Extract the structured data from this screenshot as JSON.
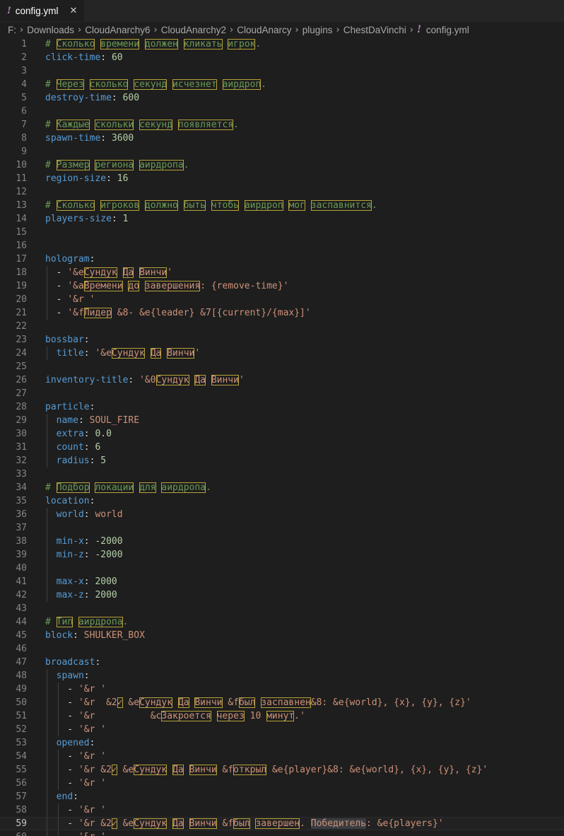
{
  "tab": {
    "label": "config.yml",
    "icon": "yaml-file-icon",
    "close": "✕"
  },
  "breadcrumb": [
    "F:",
    "Downloads",
    "CloudAnarchy6",
    "CloudAnarchy2",
    "CloudAnarcy",
    "plugins",
    "ChestDaVinchi",
    "config.yml"
  ],
  "colors": {
    "key": "#569cd6",
    "string": "#ce9178",
    "number": "#b5cea8",
    "comment": "#6a9955",
    "background": "#1e1e1e"
  },
  "current_line": 59,
  "lines": [
    {
      "n": "1",
      "t": [
        [
          "c",
          "# "
        ],
        [
          "cu",
          "Сколько"
        ],
        [
          "c",
          " "
        ],
        [
          "cu",
          "времени"
        ],
        [
          "c",
          " "
        ],
        [
          "cu",
          "должен"
        ],
        [
          "c",
          " "
        ],
        [
          "cu",
          "кликать"
        ],
        [
          "c",
          " "
        ],
        [
          "cu",
          "игрок"
        ],
        [
          "c",
          "."
        ]
      ]
    },
    {
      "n": "2",
      "t": [
        [
          "k",
          "click-time"
        ],
        [
          "p",
          ": "
        ],
        [
          "n",
          "60"
        ]
      ]
    },
    {
      "n": "3",
      "t": []
    },
    {
      "n": "4",
      "t": [
        [
          "c",
          "# "
        ],
        [
          "cu",
          "Через"
        ],
        [
          "c",
          " "
        ],
        [
          "cu",
          "сколько"
        ],
        [
          "c",
          " "
        ],
        [
          "cu",
          "секунд"
        ],
        [
          "c",
          " "
        ],
        [
          "cu",
          "исчезнет"
        ],
        [
          "c",
          " "
        ],
        [
          "cu",
          "аирдроп"
        ],
        [
          "c",
          "."
        ]
      ]
    },
    {
      "n": "5",
      "t": [
        [
          "k",
          "destroy-time"
        ],
        [
          "p",
          ": "
        ],
        [
          "n",
          "600"
        ]
      ]
    },
    {
      "n": "6",
      "t": []
    },
    {
      "n": "7",
      "t": [
        [
          "c",
          "# "
        ],
        [
          "cu",
          "Каждые"
        ],
        [
          "c",
          " "
        ],
        [
          "cu",
          "скольки"
        ],
        [
          "c",
          " "
        ],
        [
          "cu",
          "секунд"
        ],
        [
          "c",
          " "
        ],
        [
          "cu",
          "появляется"
        ],
        [
          "c",
          "."
        ]
      ]
    },
    {
      "n": "8",
      "t": [
        [
          "k",
          "spawn-time"
        ],
        [
          "p",
          ": "
        ],
        [
          "n",
          "3600"
        ]
      ]
    },
    {
      "n": "9",
      "t": []
    },
    {
      "n": "10",
      "t": [
        [
          "c",
          "# "
        ],
        [
          "cu",
          "Размер"
        ],
        [
          "c",
          " "
        ],
        [
          "cu",
          "региона"
        ],
        [
          "c",
          " "
        ],
        [
          "cu",
          "аирдропа"
        ],
        [
          "c",
          "."
        ]
      ]
    },
    {
      "n": "11",
      "t": [
        [
          "k",
          "region-size"
        ],
        [
          "p",
          ": "
        ],
        [
          "n",
          "16"
        ]
      ]
    },
    {
      "n": "12",
      "t": []
    },
    {
      "n": "13",
      "t": [
        [
          "c",
          "# "
        ],
        [
          "cu",
          "Сколько"
        ],
        [
          "c",
          " "
        ],
        [
          "cu",
          "игроков"
        ],
        [
          "c",
          " "
        ],
        [
          "cu",
          "должно"
        ],
        [
          "c",
          " "
        ],
        [
          "cu",
          "быть"
        ],
        [
          "c",
          " "
        ],
        [
          "cu",
          "чтобь"
        ],
        [
          "c",
          " "
        ],
        [
          "cu",
          "аирдроп"
        ],
        [
          "c",
          " "
        ],
        [
          "cu",
          "мог"
        ],
        [
          "c",
          " "
        ],
        [
          "cu",
          "заспавнится"
        ],
        [
          "c",
          "."
        ]
      ]
    },
    {
      "n": "14",
      "t": [
        [
          "k",
          "players-size"
        ],
        [
          "p",
          ": "
        ],
        [
          "n",
          "1"
        ]
      ]
    },
    {
      "n": "15",
      "t": []
    },
    {
      "n": "16",
      "t": []
    },
    {
      "n": "17",
      "t": [
        [
          "k",
          "hologram"
        ],
        [
          "p",
          ":"
        ]
      ]
    },
    {
      "n": "18",
      "g": [
        1
      ],
      "t": [
        [
          "p",
          "  - "
        ],
        [
          "s",
          "'&e"
        ],
        [
          "su",
          "Сундук"
        ],
        [
          "s",
          " "
        ],
        [
          "su",
          "Да"
        ],
        [
          "s",
          " "
        ],
        [
          "su",
          "Винчи"
        ],
        [
          "s",
          "'"
        ]
      ]
    },
    {
      "n": "19",
      "g": [
        1
      ],
      "t": [
        [
          "p",
          "  - "
        ],
        [
          "s",
          "'&a"
        ],
        [
          "su",
          "Времени"
        ],
        [
          "s",
          " "
        ],
        [
          "su",
          "до"
        ],
        [
          "s",
          " "
        ],
        [
          "su",
          "завершения"
        ],
        [
          "s",
          ": {remove-time}'"
        ]
      ]
    },
    {
      "n": "20",
      "g": [
        1
      ],
      "t": [
        [
          "p",
          "  - "
        ],
        [
          "s",
          "'&r '"
        ]
      ]
    },
    {
      "n": "21",
      "g": [
        1
      ],
      "t": [
        [
          "p",
          "  - "
        ],
        [
          "s",
          "'&f"
        ],
        [
          "su",
          "Лидер"
        ],
        [
          "s",
          " &8- &e{leader} &7[{current}/{max}]'"
        ]
      ]
    },
    {
      "n": "22",
      "t": []
    },
    {
      "n": "23",
      "t": [
        [
          "k",
          "bossbar"
        ],
        [
          "p",
          ":"
        ]
      ]
    },
    {
      "n": "24",
      "g": [
        1
      ],
      "t": [
        [
          "p",
          "  "
        ],
        [
          "k",
          "title"
        ],
        [
          "p",
          ": "
        ],
        [
          "s",
          "'&e"
        ],
        [
          "su",
          "Сундук"
        ],
        [
          "s",
          " "
        ],
        [
          "su",
          "Да"
        ],
        [
          "s",
          " "
        ],
        [
          "su",
          "Винчи"
        ],
        [
          "s",
          "'"
        ]
      ]
    },
    {
      "n": "25",
      "t": []
    },
    {
      "n": "26",
      "t": [
        [
          "k",
          "inventory-title"
        ],
        [
          "p",
          ": "
        ],
        [
          "s",
          "'&0"
        ],
        [
          "su",
          "Сундук"
        ],
        [
          "s",
          " "
        ],
        [
          "su",
          "Да"
        ],
        [
          "s",
          " "
        ],
        [
          "su",
          "Винчи"
        ],
        [
          "s",
          "'"
        ]
      ]
    },
    {
      "n": "27",
      "t": []
    },
    {
      "n": "28",
      "t": [
        [
          "k",
          "particle"
        ],
        [
          "p",
          ":"
        ]
      ]
    },
    {
      "n": "29",
      "g": [
        1
      ],
      "t": [
        [
          "p",
          "  "
        ],
        [
          "k",
          "name"
        ],
        [
          "p",
          ": "
        ],
        [
          "s",
          "SOUL_FIRE"
        ]
      ]
    },
    {
      "n": "30",
      "g": [
        1
      ],
      "t": [
        [
          "p",
          "  "
        ],
        [
          "k",
          "extra"
        ],
        [
          "p",
          ": "
        ],
        [
          "n",
          "0.0"
        ]
      ]
    },
    {
      "n": "31",
      "g": [
        1
      ],
      "t": [
        [
          "p",
          "  "
        ],
        [
          "k",
          "count"
        ],
        [
          "p",
          ": "
        ],
        [
          "n",
          "6"
        ]
      ]
    },
    {
      "n": "32",
      "g": [
        1
      ],
      "t": [
        [
          "p",
          "  "
        ],
        [
          "k",
          "radius"
        ],
        [
          "p",
          ": "
        ],
        [
          "n",
          "5"
        ]
      ]
    },
    {
      "n": "33",
      "t": []
    },
    {
      "n": "34",
      "t": [
        [
          "c",
          "# "
        ],
        [
          "cu",
          "Подбор"
        ],
        [
          "c",
          " "
        ],
        [
          "cu",
          "локации"
        ],
        [
          "c",
          " "
        ],
        [
          "cu",
          "для"
        ],
        [
          "c",
          " "
        ],
        [
          "cu",
          "аирдропа"
        ],
        [
          "c",
          "."
        ]
      ]
    },
    {
      "n": "35",
      "t": [
        [
          "k",
          "location"
        ],
        [
          "p",
          ":"
        ]
      ]
    },
    {
      "n": "36",
      "g": [
        1
      ],
      "t": [
        [
          "p",
          "  "
        ],
        [
          "k",
          "world"
        ],
        [
          "p",
          ": "
        ],
        [
          "s",
          "world"
        ]
      ]
    },
    {
      "n": "37",
      "g": [
        1
      ],
      "t": []
    },
    {
      "n": "38",
      "g": [
        1
      ],
      "t": [
        [
          "p",
          "  "
        ],
        [
          "k",
          "min-x"
        ],
        [
          "p",
          ": "
        ],
        [
          "n",
          "-2000"
        ]
      ]
    },
    {
      "n": "39",
      "g": [
        1
      ],
      "t": [
        [
          "p",
          "  "
        ],
        [
          "k",
          "min-z"
        ],
        [
          "p",
          ": "
        ],
        [
          "n",
          "-2000"
        ]
      ]
    },
    {
      "n": "40",
      "g": [
        1
      ],
      "t": []
    },
    {
      "n": "41",
      "g": [
        1
      ],
      "t": [
        [
          "p",
          "  "
        ],
        [
          "k",
          "max-x"
        ],
        [
          "p",
          ": "
        ],
        [
          "n",
          "2000"
        ]
      ]
    },
    {
      "n": "42",
      "g": [
        1
      ],
      "t": [
        [
          "p",
          "  "
        ],
        [
          "k",
          "max-z"
        ],
        [
          "p",
          ": "
        ],
        [
          "n",
          "2000"
        ]
      ]
    },
    {
      "n": "43",
      "t": []
    },
    {
      "n": "44",
      "t": [
        [
          "c",
          "# "
        ],
        [
          "cu",
          "Тип"
        ],
        [
          "c",
          " "
        ],
        [
          "cu",
          "аирдропа"
        ],
        [
          "c",
          "."
        ]
      ]
    },
    {
      "n": "45",
      "t": [
        [
          "k",
          "block"
        ],
        [
          "p",
          ": "
        ],
        [
          "s",
          "SHULKER_BOX"
        ]
      ]
    },
    {
      "n": "46",
      "t": []
    },
    {
      "n": "47",
      "t": [
        [
          "k",
          "broadcast"
        ],
        [
          "p",
          ":"
        ]
      ]
    },
    {
      "n": "48",
      "g": [
        1
      ],
      "t": [
        [
          "p",
          "  "
        ],
        [
          "k",
          "spawn"
        ],
        [
          "p",
          ":"
        ]
      ]
    },
    {
      "n": "49",
      "g": [
        1,
        2
      ],
      "t": [
        [
          "p",
          "    - "
        ],
        [
          "s",
          "'&r '"
        ]
      ]
    },
    {
      "n": "50",
      "g": [
        1,
        2
      ],
      "t": [
        [
          "p",
          "    - "
        ],
        [
          "s",
          "'&r  &2"
        ],
        [
          "su",
          "✓"
        ],
        [
          "s",
          " &e"
        ],
        [
          "su",
          "Сундук"
        ],
        [
          "s",
          " "
        ],
        [
          "su",
          "Да"
        ],
        [
          "s",
          " "
        ],
        [
          "su",
          "Винчи"
        ],
        [
          "s",
          " &f"
        ],
        [
          "su",
          "был"
        ],
        [
          "s",
          " "
        ],
        [
          "su",
          "заспавнен"
        ],
        [
          "s",
          "&8: &e{world}, {x}, {y}, {z}'"
        ]
      ]
    },
    {
      "n": "51",
      "g": [
        1,
        2
      ],
      "t": [
        [
          "p",
          "    - "
        ],
        [
          "s",
          "'&r          &c"
        ],
        [
          "su",
          "Закроется"
        ],
        [
          "s",
          " "
        ],
        [
          "su",
          "через"
        ],
        [
          "s",
          " 10 "
        ],
        [
          "su",
          "минут"
        ],
        [
          "s",
          ".'"
        ]
      ]
    },
    {
      "n": "52",
      "g": [
        1,
        2
      ],
      "t": [
        [
          "p",
          "    - "
        ],
        [
          "s",
          "'&r '"
        ]
      ]
    },
    {
      "n": "53",
      "g": [
        1
      ],
      "t": [
        [
          "p",
          "  "
        ],
        [
          "k",
          "opened"
        ],
        [
          "p",
          ":"
        ]
      ]
    },
    {
      "n": "54",
      "g": [
        1,
        2
      ],
      "t": [
        [
          "p",
          "    - "
        ],
        [
          "s",
          "'&r '"
        ]
      ]
    },
    {
      "n": "55",
      "g": [
        1,
        2
      ],
      "t": [
        [
          "p",
          "    - "
        ],
        [
          "s",
          "'&r &2"
        ],
        [
          "su",
          "✓"
        ],
        [
          "s",
          " &e"
        ],
        [
          "su",
          "Сундук"
        ],
        [
          "s",
          " "
        ],
        [
          "su",
          "Да"
        ],
        [
          "s",
          " "
        ],
        [
          "su",
          "Винчи"
        ],
        [
          "s",
          " &f"
        ],
        [
          "su",
          "открыл"
        ],
        [
          "s",
          " &e{player}&8: &e{world}, {x}, {y}, {z}'"
        ]
      ]
    },
    {
      "n": "56",
      "g": [
        1,
        2
      ],
      "t": [
        [
          "p",
          "    - "
        ],
        [
          "s",
          "'&r '"
        ]
      ]
    },
    {
      "n": "57",
      "g": [
        1
      ],
      "t": [
        [
          "p",
          "  "
        ],
        [
          "k",
          "end"
        ],
        [
          "p",
          ":"
        ]
      ]
    },
    {
      "n": "58",
      "g": [
        1,
        2
      ],
      "t": [
        [
          "p",
          "    - "
        ],
        [
          "s",
          "'&r '"
        ]
      ]
    },
    {
      "n": "59",
      "g": [
        1,
        2
      ],
      "t": [
        [
          "p",
          "    - "
        ],
        [
          "s",
          "'&r &2"
        ],
        [
          "su",
          "✓"
        ],
        [
          "s",
          " &e"
        ],
        [
          "su",
          "Сундук"
        ],
        [
          "s",
          " "
        ],
        [
          "su",
          "Да"
        ],
        [
          "s",
          " "
        ],
        [
          "su",
          "Винчи"
        ],
        [
          "s",
          " &f"
        ],
        [
          "su",
          "был"
        ],
        [
          "s",
          " "
        ],
        [
          "su",
          "завершен"
        ],
        [
          "s",
          ". "
        ],
        [
          "sh",
          "Победитель"
        ],
        [
          "s",
          ": &e{players}'"
        ]
      ]
    },
    {
      "n": "60",
      "g": [
        1,
        2
      ],
      "t": [
        [
          "p",
          "    - "
        ],
        [
          "s",
          "'&r '"
        ]
      ]
    }
  ]
}
